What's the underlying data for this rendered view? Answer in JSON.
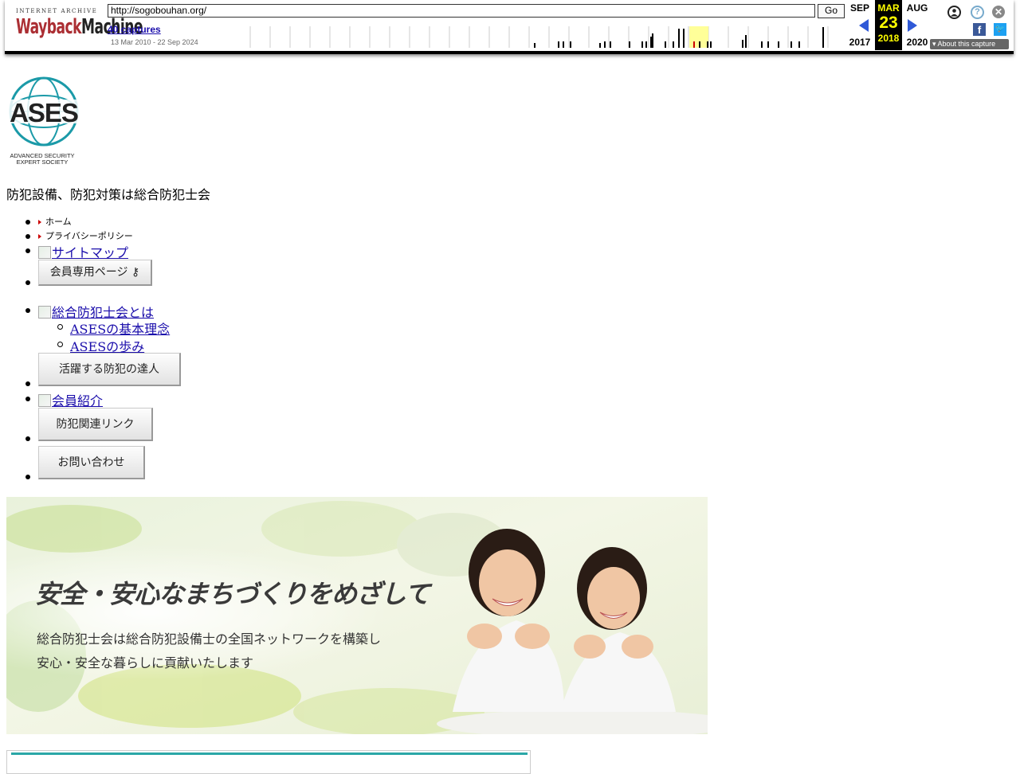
{
  "wayback": {
    "logo_top": "INTERNET ARCHIVE",
    "logo_main_a": "Wayback",
    "logo_main_b": "Machine",
    "url": "http://sogobouhan.org/",
    "go_label": "Go",
    "captures": "40 captures",
    "range": "13 Mar 2010 - 22 Sep 2024",
    "prev_month": "SEP",
    "prev_year": "2017",
    "cur_month": "MAR",
    "cur_day": "23",
    "cur_year": "2018",
    "next_month": "AUG",
    "next_year": "2020",
    "about": "About this capture",
    "icons": [
      "user-icon",
      "help-icon",
      "close-icon",
      "facebook-icon",
      "twitter-icon"
    ]
  },
  "site": {
    "logo_word": "ASES",
    "logo_sub1": "ADVANCED SECURITY",
    "logo_sub2": "EXPERT SOCIETY",
    "tagline": "防犯設備、防犯対策は総合防犯士会",
    "nav": {
      "home": "ホーム",
      "privacy": "プライバシーポリシー",
      "sitemap": "サイトマップ",
      "members_page": "会員専用ページ",
      "about": "総合防犯士会とは",
      "about_sub": [
        "ASESの基本理念",
        "ASESの歩み"
      ],
      "experts": "活躍する防犯の達人",
      "members": "会員紹介",
      "links": "防犯関連リンク",
      "contact": "お問い合わせ"
    },
    "banner": {
      "headline": "安全・安心なまちづくりをめざして",
      "line1": "総合防犯士会は総合防犯設備士の全国ネットワークを構築し",
      "line2": "安心・安全な暮らしに貢献いたします"
    }
  }
}
